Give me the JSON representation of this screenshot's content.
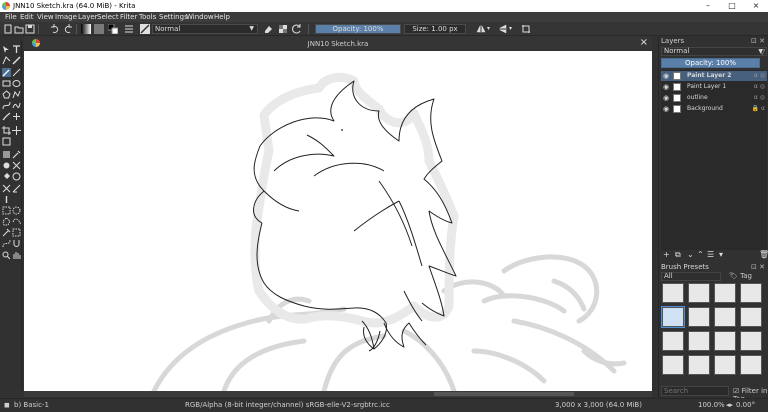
{
  "window": {
    "title": "JNN10 Sketch.kra (64.0 MiB) - Krita",
    "minimize": "–",
    "maximize": "□",
    "close": "×"
  },
  "menu": [
    "File",
    "Edit",
    "View",
    "Image",
    "Layer",
    "Select",
    "Filter",
    "Tools",
    "Settings",
    "Window",
    "Help"
  ],
  "toolbar": {
    "blend_mode": "Normal",
    "opacity_label": "Opacity: 100%",
    "opacity": 1.0,
    "size_label": "Size: 1.00 px"
  },
  "document": {
    "tab_title": "JNN10 Sketch.kra",
    "close": "×"
  },
  "layers_panel": {
    "title": "Layers",
    "blend_mode": "Normal",
    "opacity_label": "Opacity:  100%",
    "layers": [
      {
        "name": "Paint Layer 2",
        "active": true
      },
      {
        "name": "Paint Layer 1",
        "active": false
      },
      {
        "name": "outline",
        "active": false
      },
      {
        "name": "Background",
        "active": false
      }
    ]
  },
  "brush_presets": {
    "title": "Brush Presets",
    "filter": "All",
    "tag": "Tag",
    "search_placeholder": "Search",
    "filter_in_tag": "Filter in Tag"
  },
  "status": {
    "preset": "b) Basic-1",
    "color_profile": "RGB/Alpha (8-bit integer/channel)  sRGB-elle-V2-srgbtrc.icc",
    "image_size": "3,000 x 3,000 (64.0 MiB)",
    "zoom": "100.0%",
    "rotation": "0.00°"
  },
  "colors": {
    "accent": "#5a7fa8",
    "active_layer": "#46607e",
    "background": "#313131"
  }
}
